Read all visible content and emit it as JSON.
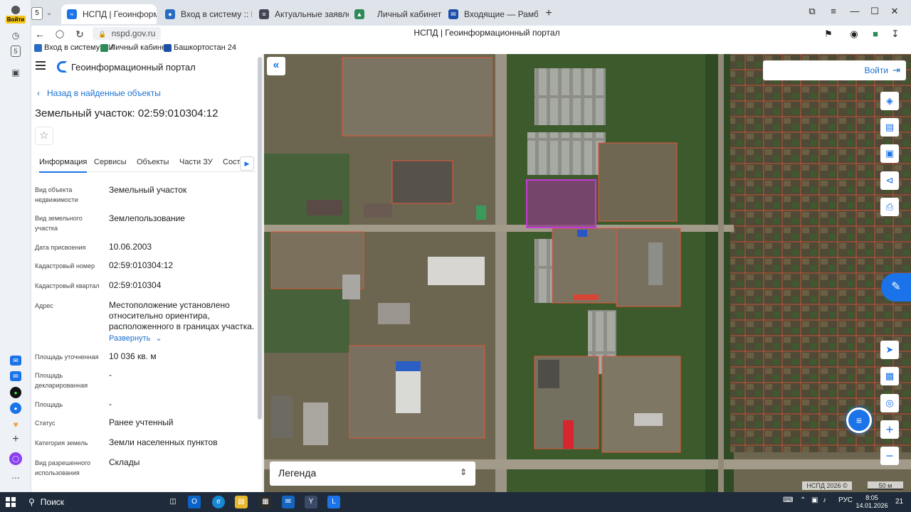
{
  "browser": {
    "login_badge": "Войти",
    "tab_count": "5",
    "tabs": [
      {
        "title": "НСПД | Геоинформаци",
        "active": true
      },
      {
        "title": "Вход в систему :: Имущес",
        "active": false
      },
      {
        "title": "Актуальные заявления",
        "active": false
      },
      {
        "title": "Личный кабинет",
        "active": false
      },
      {
        "title": "Входящие — Рамблер/по",
        "active": false
      }
    ],
    "url": "nspd.gov.ru",
    "page_title": "НСПД | Геоинформационный портал",
    "bookmarks": [
      "Вход в систему :: И",
      "Личный кабинет",
      "Башкортостан 24"
    ],
    "sidebar_badge": "5"
  },
  "panel": {
    "app_title": "Геоинформационный портал",
    "back_label": "Назад в найденные объекты",
    "object_title": "Земельный участок: 02:59:010304:12",
    "tabs": [
      "Информация",
      "Сервисы",
      "Объекты",
      "Части ЗУ",
      "Соста"
    ],
    "fields": [
      {
        "label": "Вид объекта недвижимости",
        "value": "Земельный участок"
      },
      {
        "label": "Вид земельного участка",
        "value": "Землепользование"
      },
      {
        "label": "Дата присвоения",
        "value": "10.06.2003"
      },
      {
        "label": "Кадастровый номер",
        "value": "02:59:010304:12"
      },
      {
        "label": "Кадастровый квартал",
        "value": "02:59:010304"
      },
      {
        "label": "Адрес",
        "value": "Местоположение установлено относительно ориентира, расположенного в границах участка."
      },
      {
        "label": "Площадь уточненная",
        "value": "10 036 кв. м"
      },
      {
        "label": "Площадь декларированная",
        "value": "-"
      },
      {
        "label": "Площадь",
        "value": "-"
      },
      {
        "label": "Статус",
        "value": "Ранее учтенный"
      },
      {
        "label": "Категория земель",
        "value": "Земли населенных пунктов"
      },
      {
        "label": "Вид разрешенного использования",
        "value": "Склады"
      }
    ],
    "expand_label": "Развернуть"
  },
  "map": {
    "login_label": "Войти",
    "legend_label": "Легенда",
    "copyright": "НСПД 2026 ©",
    "scale": "50 м",
    "colors": {
      "parcel_border": "#e2553a",
      "selected_parcel": "#b23bd1",
      "accent": "#1a73e8"
    }
  },
  "taskbar": {
    "search_label": "Поиск",
    "lang": "РУС",
    "time": "8:05",
    "date": "14.01.2026",
    "notif_count": "21"
  }
}
